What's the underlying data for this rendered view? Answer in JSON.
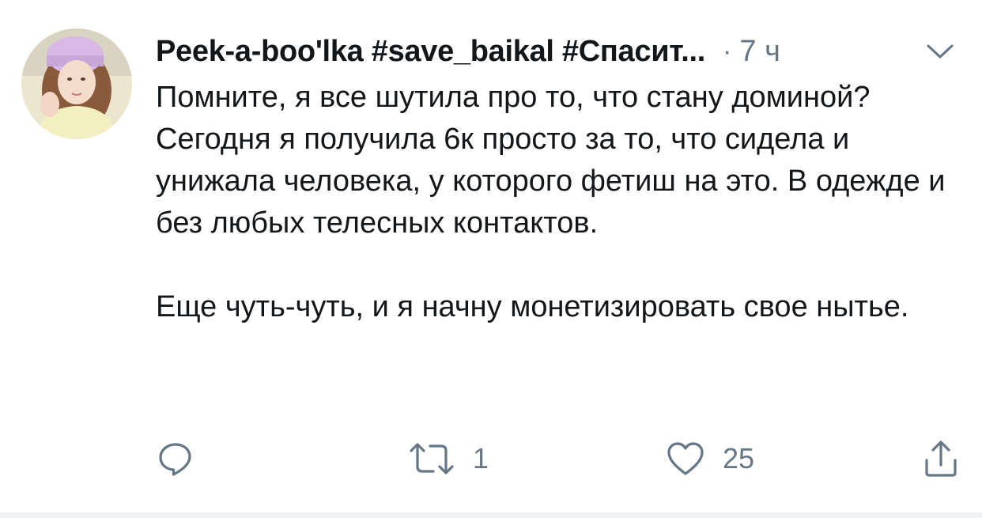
{
  "author": {
    "name": "Peek-a-boo'lka #save_baikal #Спасит...",
    "separator": "·",
    "timestamp": "7 ч"
  },
  "tweet": {
    "paragraphs": [
      "Помните, я все шутила про то, что стану доминой? Сегодня я получила 6к просто за то, что сидела и унижала человека, у которого фетиш на это. В одежде и без любых телесных контактов.",
      "Еще чуть-чуть, и я начну монетизировать свое нытье."
    ]
  },
  "actions": {
    "reply_icon": "reply-icon",
    "retweet_icon": "retweet-icon",
    "retweet_count": "1",
    "like_icon": "like-icon",
    "like_count": "25",
    "share_icon": "share-icon"
  },
  "colors": {
    "text": "#14171a",
    "secondary": "#657786",
    "divider": "#eff2f4"
  }
}
